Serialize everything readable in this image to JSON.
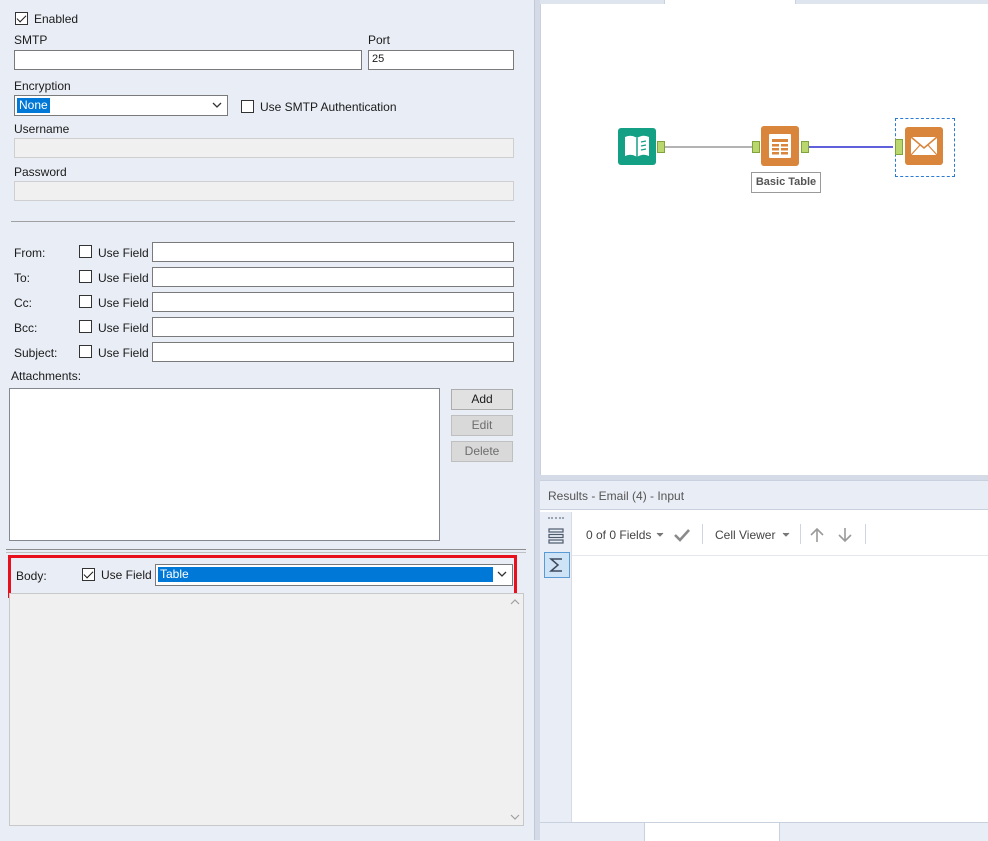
{
  "config": {
    "enabled_label": "Enabled",
    "enabled_checked": true,
    "smtp_label": "SMTP",
    "smtp_value": "",
    "port_label": "Port",
    "port_value": "25",
    "encryption_label": "Encryption",
    "encryption_value": "None",
    "smtp_auth_label": "Use SMTP Authentication",
    "smtp_auth_checked": false,
    "username_label": "Username",
    "password_label": "Password",
    "address_rows": [
      {
        "label": "From:",
        "use_field_label": "Use Field",
        "checked": false,
        "value": ""
      },
      {
        "label": "To:",
        "use_field_label": "Use Field",
        "checked": false,
        "value": ""
      },
      {
        "label": "Cc:",
        "use_field_label": "Use Field",
        "checked": false,
        "value": ""
      },
      {
        "label": "Bcc:",
        "use_field_label": "Use Field",
        "checked": false,
        "value": ""
      },
      {
        "label": "Subject:",
        "use_field_label": "Use Field",
        "checked": false,
        "value": ""
      }
    ],
    "attachments_label": "Attachments:",
    "buttons": {
      "add": "Add",
      "edit": "Edit",
      "delete": "Delete"
    },
    "body_label": "Body:",
    "body_use_field_label": "Use Field",
    "body_use_field_checked": true,
    "body_field_value": "Table",
    "highlight_color": "#e8101c"
  },
  "workflow": {
    "nodes": [
      {
        "id": "input",
        "icon": "book-input-icon",
        "color": "#13a085"
      },
      {
        "id": "basic-table",
        "icon": "table-icon",
        "color": "#d9853b",
        "label": "Basic Table"
      },
      {
        "id": "email",
        "icon": "envelope-icon",
        "color": "#d9853b",
        "selected": true
      }
    ]
  },
  "results": {
    "title": "Results - Email (4) - Input",
    "fields_text": "0 of 0 Fields",
    "cell_viewer_label": "Cell Viewer"
  }
}
